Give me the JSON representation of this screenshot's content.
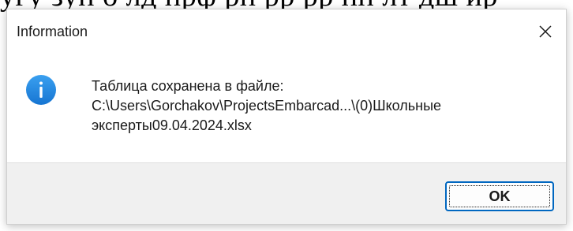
{
  "background": {
    "partial_text": "угу зуп о лд прф рп рр  рр пп лт дш ир"
  },
  "dialog": {
    "title": "Information",
    "close_glyph": "✕",
    "icon": "info-icon",
    "message_lines": [
      "Таблица сохранена в файле:",
      "C:\\Users\\Gorchakov\\ProjectsEmbarcad...\\(0)Школьные",
      "эксперты09.04.2024.xlsx"
    ],
    "ok_label": "OK"
  },
  "colors": {
    "info_blue": "#1e88e5",
    "ok_border": "#0067c0",
    "footer_bg": "#f0f0f0"
  }
}
